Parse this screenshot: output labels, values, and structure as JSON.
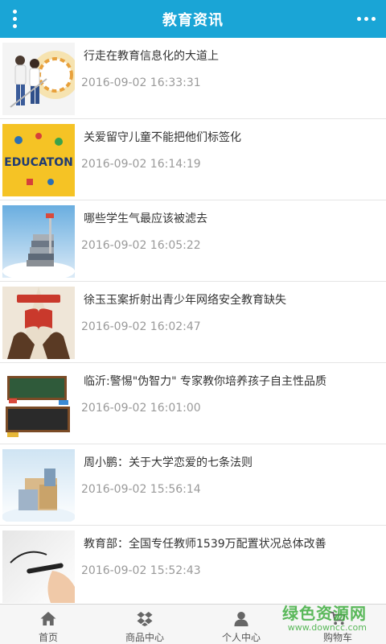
{
  "header": {
    "title": "教育资讯",
    "menu_icon": "menu-icon",
    "more_icon": "more-icon"
  },
  "colors": {
    "header_bg": "#1aa5d6",
    "title_text": "#333333",
    "time_text": "#9a9a9a",
    "watermark": "#3fae3f"
  },
  "articles": [
    {
      "title": "行走在教育信息化的大道上",
      "time": "2016-09-02 16:33:31",
      "thumb": "students-image"
    },
    {
      "title": "关爱留守儿童不能把他们标签化",
      "time": "2016-09-02 16:14:19",
      "thumb": "education-image"
    },
    {
      "title": "哪些学生气最应该被滤去",
      "time": "2016-09-02 16:05:22",
      "thumb": "books-image"
    },
    {
      "title": "徐玉玉案折射出青少年网络安全教育缺失",
      "time": "2016-09-02 16:02:47",
      "thumb": "hands-book-image"
    },
    {
      "title": "临沂:警惕\"伪智力\" 专家教你培养孩子自主性品质",
      "time": "2016-09-02 16:01:00",
      "thumb": "chalkboard-image"
    },
    {
      "title": "周小鹏：关于大学恋爱的七条法则",
      "time": "2016-09-02 15:56:14",
      "thumb": "stacked-books-image"
    },
    {
      "title": "教育部：全国专任教师1539万配置状况总体改善",
      "time": "2016-09-02 15:52:43",
      "thumb": "pen-writing-image"
    }
  ],
  "tabbar": [
    {
      "label": "首页",
      "icon": "home-icon"
    },
    {
      "label": "商品中心",
      "icon": "dropbox-icon"
    },
    {
      "label": "个人中心",
      "icon": "user-icon"
    },
    {
      "label": "购物车",
      "icon": "cart-icon"
    }
  ],
  "watermark": {
    "main": "绿色资源网",
    "sub": "www.downcc.com"
  }
}
